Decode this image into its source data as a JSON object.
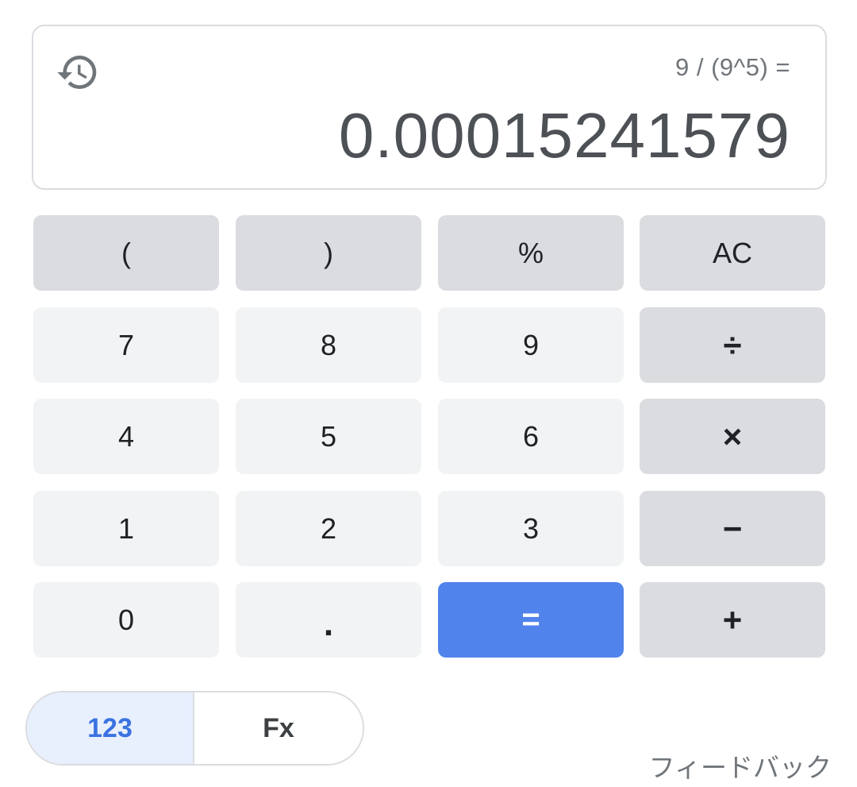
{
  "display": {
    "history_icon": "history-icon",
    "expression": "9 / (9^5) =",
    "result": "0.00015241579"
  },
  "keys": {
    "open_paren": "(",
    "close_paren": ")",
    "percent": "%",
    "clear": "AC",
    "seven": "7",
    "eight": "8",
    "nine": "9",
    "divide": "÷",
    "four": "4",
    "five": "5",
    "six": "6",
    "multiply": "×",
    "one": "1",
    "two": "2",
    "three": "3",
    "minus": "−",
    "zero": "0",
    "decimal": ".",
    "equals": "=",
    "plus": "+"
  },
  "mode": {
    "basic_label": "123",
    "functions_label": "Fx",
    "active": "123"
  },
  "feedback_label": "フィードバック",
  "colors": {
    "accent": "#5183ec",
    "number_key": "#f1f3f4",
    "operator_key": "#dadce0",
    "active_mode_bg": "#e8f0fe",
    "active_mode_text": "#3a73e1"
  }
}
